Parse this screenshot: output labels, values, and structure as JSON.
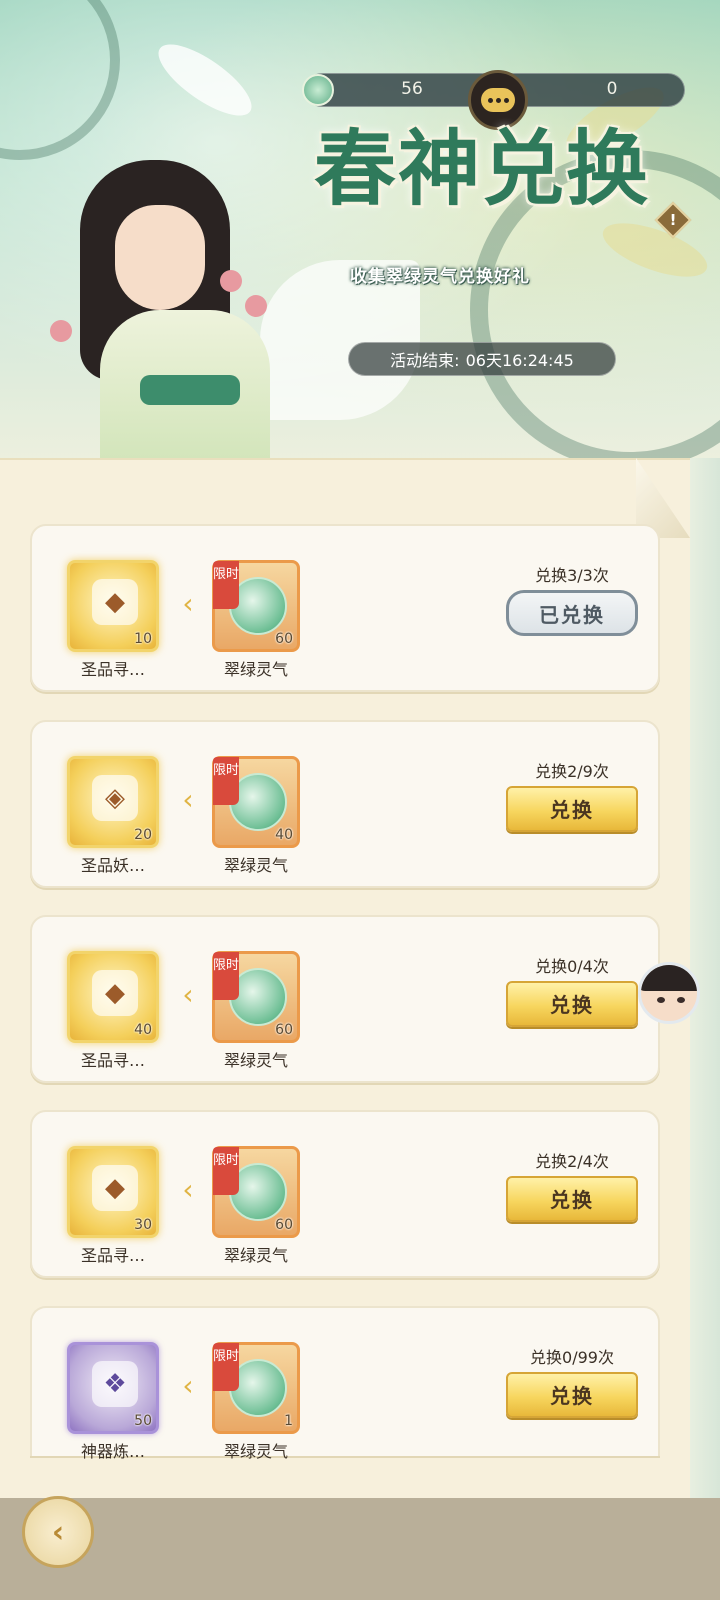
{
  "banner": {
    "title": "春神兑换",
    "subtitle": "收集翠绿灵气兑换好礼",
    "countdown_label": "活动结束:",
    "countdown_value": "06天16:24:45",
    "info_icon": "!"
  },
  "currency": {
    "icon": "jade-orb-icon",
    "left_value": "56",
    "right_value": "0"
  },
  "exchange_items": [
    {
      "reward_name": "圣品寻…",
      "reward_qty": "10",
      "reward_frame": "gold",
      "cost_tag": "限时",
      "cost_name": "翠绿灵气",
      "cost_qty": "60",
      "count_label": "兑换3/3次",
      "button_label": "已兑换",
      "button_state": "done"
    },
    {
      "reward_name": "圣品妖…",
      "reward_qty": "20",
      "reward_frame": "gold",
      "cost_tag": "限时",
      "cost_name": "翠绿灵气",
      "cost_qty": "40",
      "count_label": "兑换2/9次",
      "button_label": "兑换",
      "button_state": "active"
    },
    {
      "reward_name": "圣品寻…",
      "reward_qty": "40",
      "reward_frame": "gold",
      "cost_tag": "限时",
      "cost_name": "翠绿灵气",
      "cost_qty": "60",
      "count_label": "兑换0/4次",
      "button_label": "兑换",
      "button_state": "active"
    },
    {
      "reward_name": "圣品寻…",
      "reward_qty": "30",
      "reward_frame": "gold",
      "cost_tag": "限时",
      "cost_name": "翠绿灵气",
      "cost_qty": "60",
      "count_label": "兑换2/4次",
      "button_label": "兑换",
      "button_state": "active"
    },
    {
      "reward_name": "神器炼…",
      "reward_qty": "50",
      "reward_frame": "purple",
      "cost_tag": "限时",
      "cost_name": "翠绿灵气",
      "cost_qty": "1",
      "count_label": "兑换0/99次",
      "button_label": "兑换",
      "button_state": "active"
    }
  ],
  "colors": {
    "accent_gold": "#f7d65f",
    "jade_green": "#2f7a5b",
    "limit_red": "#d94a3c"
  }
}
